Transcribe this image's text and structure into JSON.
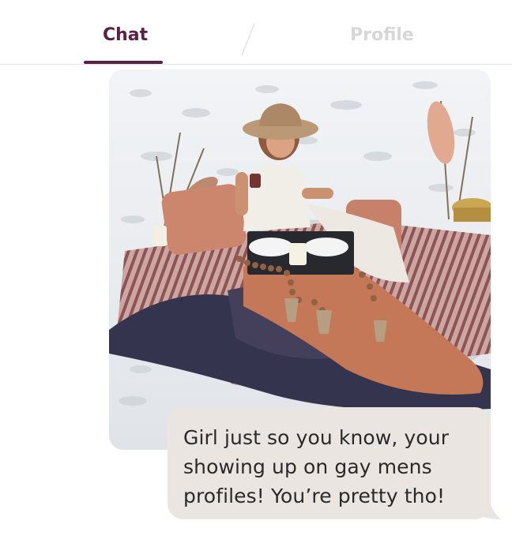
{
  "tabs": {
    "chat_label": "Chat",
    "profile_label": "Profile",
    "active": "Chat"
  },
  "colors": {
    "accent": "#5a2146",
    "inactive_tab": "#d7d7d7",
    "bubble_bg": "#ebe5e1",
    "text": "#2a2a2a"
  },
  "messages": [
    {
      "type": "photo",
      "icon": "beach-picnic-photo"
    },
    {
      "type": "text",
      "text": "Girl just so you know, your showing up on gay mens profiles! You’re pretty tho!"
    }
  ]
}
